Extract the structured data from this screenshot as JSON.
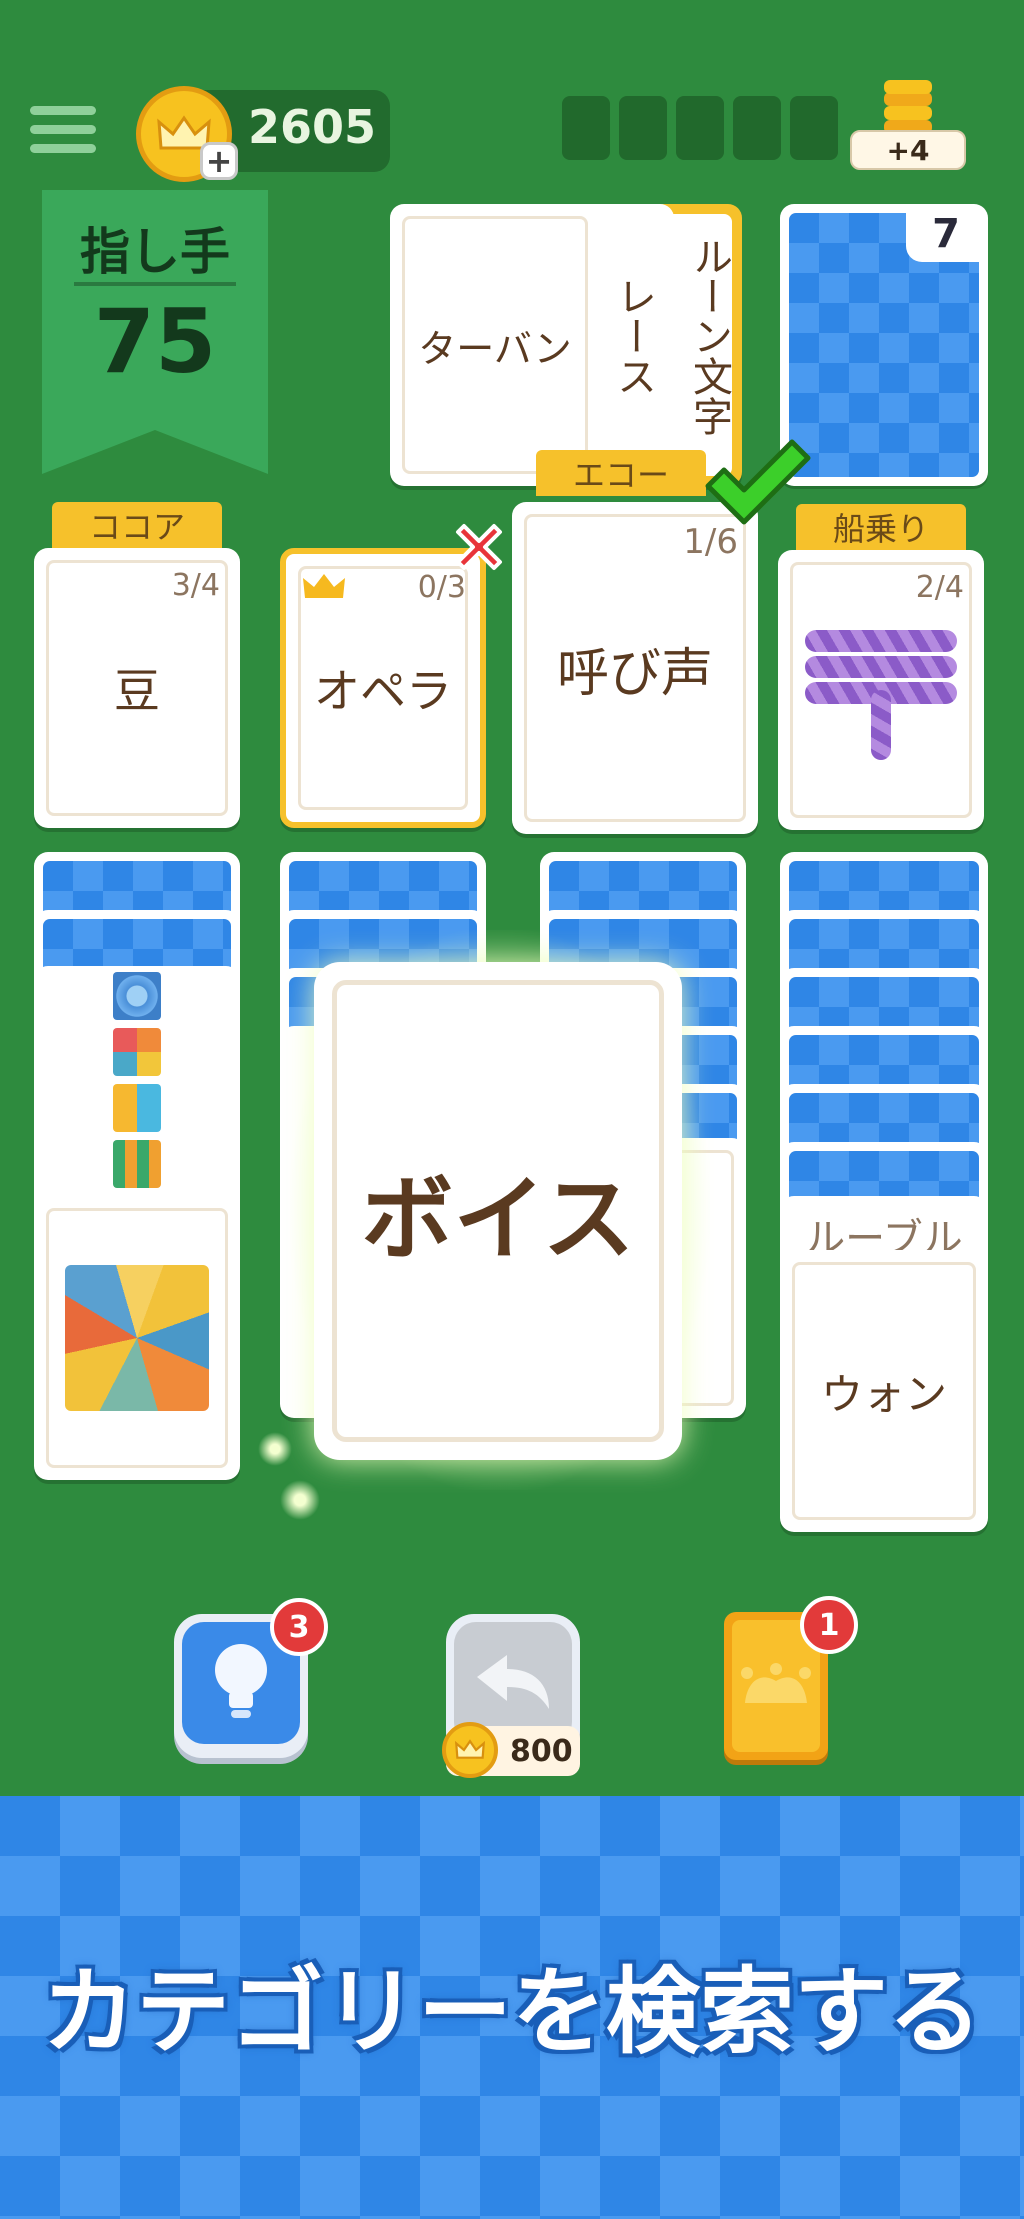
{
  "header": {
    "menu_icon": "hamburger-menu-icon",
    "coins": "2605",
    "coin_icon": "crown-coin-icon",
    "add_icon": "plus-icon",
    "bonus_label": "+4",
    "bonus_icon": "coin-stack-icon"
  },
  "moves": {
    "label": "指し手",
    "value": "75"
  },
  "top_row": {
    "revealed_cards": [
      "ターバン",
      "レース",
      "ルーン文字"
    ],
    "deck_count": "7"
  },
  "foundations": [
    {
      "category": "ココア",
      "card": "豆",
      "progress": "3/4"
    },
    {
      "category": "",
      "card": "オペラ",
      "progress": "0/3"
    },
    {
      "category": "エコー",
      "card": "呼び声",
      "progress": "1/6"
    },
    {
      "category": "船乗り",
      "card": "",
      "progress": "2/4",
      "image": "rope-icon"
    }
  ],
  "tableau": {
    "col4_label": "ルーブル",
    "col4_card": "ウォン",
    "dragged_card": "ボイス"
  },
  "tools": {
    "hint_badge": "3",
    "undo_cost": "800",
    "joker_badge": "1"
  },
  "footer": {
    "caption": "カテゴリーを検索する"
  },
  "colors": {
    "felt": "#2e8b3e",
    "card_back": "#2f86e6",
    "banner": "#f6c12b",
    "accent_red": "#e23a3a",
    "check_green": "#3ccf2a"
  }
}
